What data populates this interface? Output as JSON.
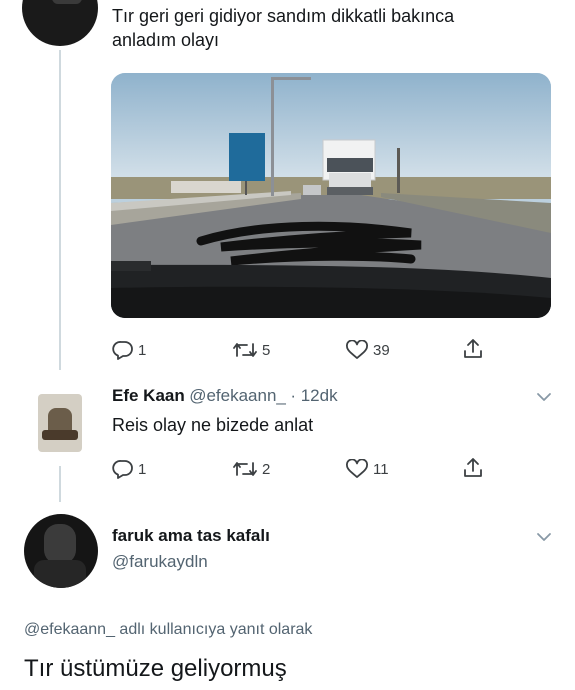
{
  "tweet1": {
    "text_line1": "Tır geri geri gidiyor sandım dikkatli bakınca",
    "text_line2": "anladım olayı",
    "actions": {
      "replies": "1",
      "retweets": "5",
      "likes": "39"
    }
  },
  "reply1": {
    "name": "Efe Kaan",
    "handle": "@efekaann_",
    "time": "· 12dk",
    "text": "Reis olay ne bizede anlat",
    "actions": {
      "replies": "1",
      "retweets": "2",
      "likes": "11"
    }
  },
  "reply2": {
    "name": "faruk ama tas kafalı",
    "handle": "@farukaydln",
    "reply_to": "@efekaann_ adlı kullanıcıya yanıt olarak",
    "text": "Tır üstümüze geliyormuş"
  },
  "photo_sign": {
    "color": "#1f6b9b"
  },
  "colors": {
    "line": "#cfd9de",
    "icon": "#3c4043",
    "muted": "#536471"
  }
}
